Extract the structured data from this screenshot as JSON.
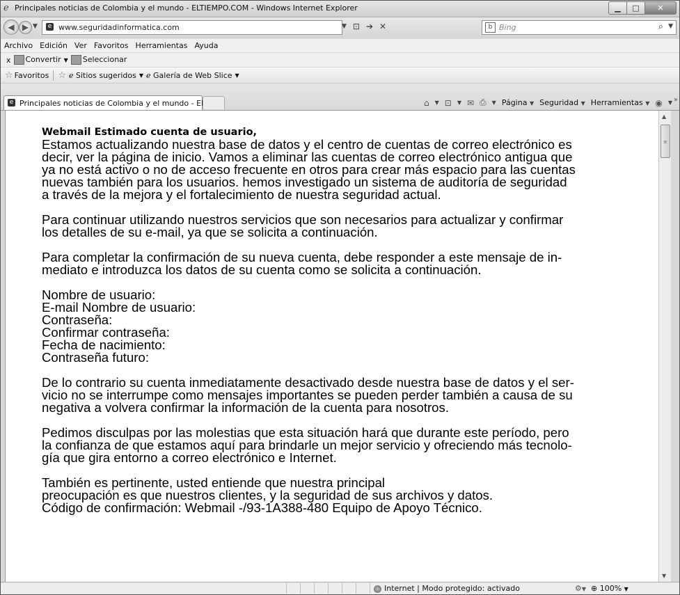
{
  "window": {
    "title": "Principales noticias de Colombia y el mundo - ELTIEMPO.COM - Windows Internet Explorer",
    "min_glyph": "▁",
    "max_glyph": "□",
    "close_glyph": "✕"
  },
  "address_bar": {
    "url": "www.seguridadinformatica.com",
    "search_placeholder": "Bing",
    "back_glyph": "◀",
    "forward_glyph": "▶",
    "refresh_glyph": "➔",
    "stop_glyph": "✕",
    "compat_glyph": "⊡",
    "dropdown_glyph": "▼"
  },
  "menu": [
    "Archivo",
    "Edición",
    "Ver",
    "Favoritos",
    "Herramientas",
    "Ayuda"
  ],
  "convert_bar": {
    "close_glyph": "x",
    "convert_label": "Convertir",
    "select_label": "Seleccionar"
  },
  "favorites_bar": {
    "favorites_label": "Favoritos",
    "suggested_sites": "Sitios sugeridos",
    "web_slice_gallery": "Galería de Web Slice"
  },
  "tab": {
    "label": "Principales noticias de Colombia y el mundo - EL..."
  },
  "command_bar": {
    "page": "Página",
    "safety": "Seguridad",
    "tools": "Herramientas",
    "overflow": "»"
  },
  "email": {
    "heading": "Webmail Estimado cuenta de usuario,",
    "paragraphs": [
      " Estamos actualizando nuestra base de datos y el centro de cuentas de correo electrónico es\ndecir, ver la página de inicio. Vamos a eliminar las cuentas de correo electrónico antigua que\nya no está activo o no de acceso frecuente en otros para crear más espacio para las cuentas\nnuevas también para los usuarios. hemos investigado un sistema de auditoría de seguridad\na través de la mejora y el fortalecimiento de nuestra seguridad actual.",
      " Para continuar utilizando nuestros servicios que son necesarios para actualizar y confirmar\nlos detalles de su e-mail, ya que se solicita a continuación.",
      " Para completar la confirmación de su nueva cuenta, debe responder a este mensaje de in-\nmediato e introduzca los datos de su cuenta como se solicita a continuación.",
      " Nombre de usuario:\n E-mail Nombre de usuario:\n Contraseña:\n Confirmar contraseña:\n Fecha de nacimiento:\n Contraseña futuro:",
      " De lo contrario su cuenta inmediatamente desactivado desde nuestra base de datos y el ser-\nvicio no se interrumpe como mensajes importantes se pueden perder también a causa de su\nnegativa a volvera confirmar la información de la cuenta para nosotros.",
      " Pedimos disculpas por las molestias que esta situación hará que durante este período, pero\nla confianza de que estamos aquí para brindarle un mejor servicio y ofreciendo más tecnolo-\ngía que gira entorno a correo electrónico e Internet.",
      " También es pertinente, usted entiende que nuestra principal\n preocupación es que nuestros clientes, y la seguridad de sus archivos y datos.\n Código de confirmación: Webmail -/93-1A388-480 Equipo de Apoyo Técnico."
    ]
  },
  "status_bar": {
    "zone": "Internet | Modo protegido: activado",
    "zoom": "100%"
  }
}
